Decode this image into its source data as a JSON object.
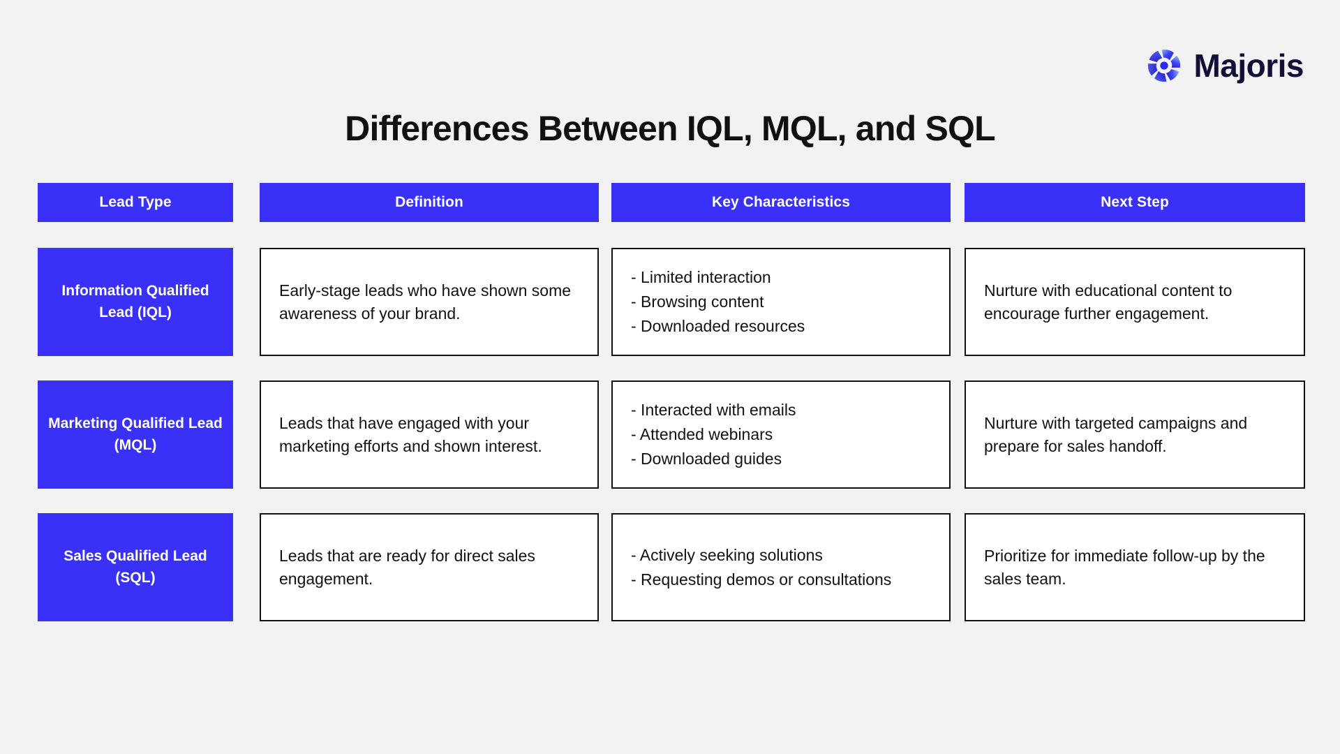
{
  "brand": {
    "name": "Majoris",
    "mark": "majoris-aperture-logo",
    "mark_color": "#2a2af0",
    "text_color": "#121037"
  },
  "title": "Differences Between IQL, MQL, and SQL",
  "theme": {
    "accent": "#3a31f8",
    "background": "#f2f2f3",
    "cell_background": "#ffffff",
    "border": "#111111",
    "text": "#111111",
    "header_text": "#ffffff"
  },
  "table": {
    "headers": [
      "Lead Type",
      "Definition",
      "Key Characteristics",
      "Next Step"
    ],
    "rows": [
      {
        "lead_type": "Information\nQualified Lead (IQL)",
        "definition": "Early-stage leads who have shown some awareness of your brand.",
        "key_characteristics": "- Limited interaction\n- Browsing content\n- Downloaded resources",
        "next_step": "Nurture with educational content to encourage further engagement."
      },
      {
        "lead_type": "Marketing Qualified\nLead (MQL)",
        "definition": "Leads that have engaged with your marketing efforts and shown interest.",
        "key_characteristics": "- Interacted with emails\n- Attended webinars\n- Downloaded guides",
        "next_step": "Nurture with targeted campaigns and prepare for sales handoff."
      },
      {
        "lead_type": "Sales Qualified\nLead (SQL)",
        "definition": "Leads that are ready for direct sales engagement.",
        "key_characteristics": "- Actively seeking solutions\n- Requesting demos or consultations",
        "next_step": "Prioritize for immediate follow-up by the sales team."
      }
    ]
  }
}
